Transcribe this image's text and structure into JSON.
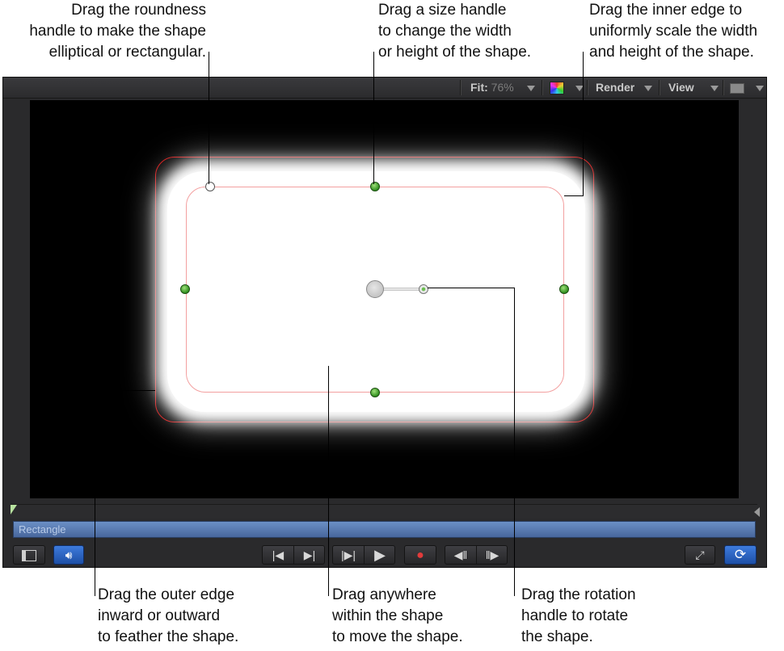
{
  "callouts": {
    "roundness": [
      "Drag the roundness",
      "handle to make the shape",
      "elliptical or rectangular."
    ],
    "size": [
      "Drag a size handle",
      "to change the width",
      "or height of the shape."
    ],
    "inner_edge": [
      "Drag the inner edge to",
      "uniformly scale the width",
      "and height of the shape."
    ],
    "outer_edge": [
      "Drag the outer edge",
      "inward or outward",
      "to feather the shape."
    ],
    "anywhere": [
      "Drag anywhere",
      "within the shape",
      "to move the shape."
    ],
    "rotation": [
      "Drag the rotation",
      "handle to rotate",
      "the shape."
    ]
  },
  "toolbar": {
    "fit_label": "Fit:",
    "fit_value": "76%",
    "render_label": "Render",
    "view_label": "View"
  },
  "timeline": {
    "layer_name": "Rectangle"
  },
  "icons": {
    "dropdown": "▼",
    "go_to_start": "|◀",
    "play": "▶",
    "record": "●",
    "loop": "⟳"
  },
  "colors": {
    "canvas": "#000000",
    "shape_outer_edge": "#d41010",
    "handle_green": "#2f8f1e",
    "track_blue": "#5578b0",
    "active_blue": "#2a64c4"
  }
}
